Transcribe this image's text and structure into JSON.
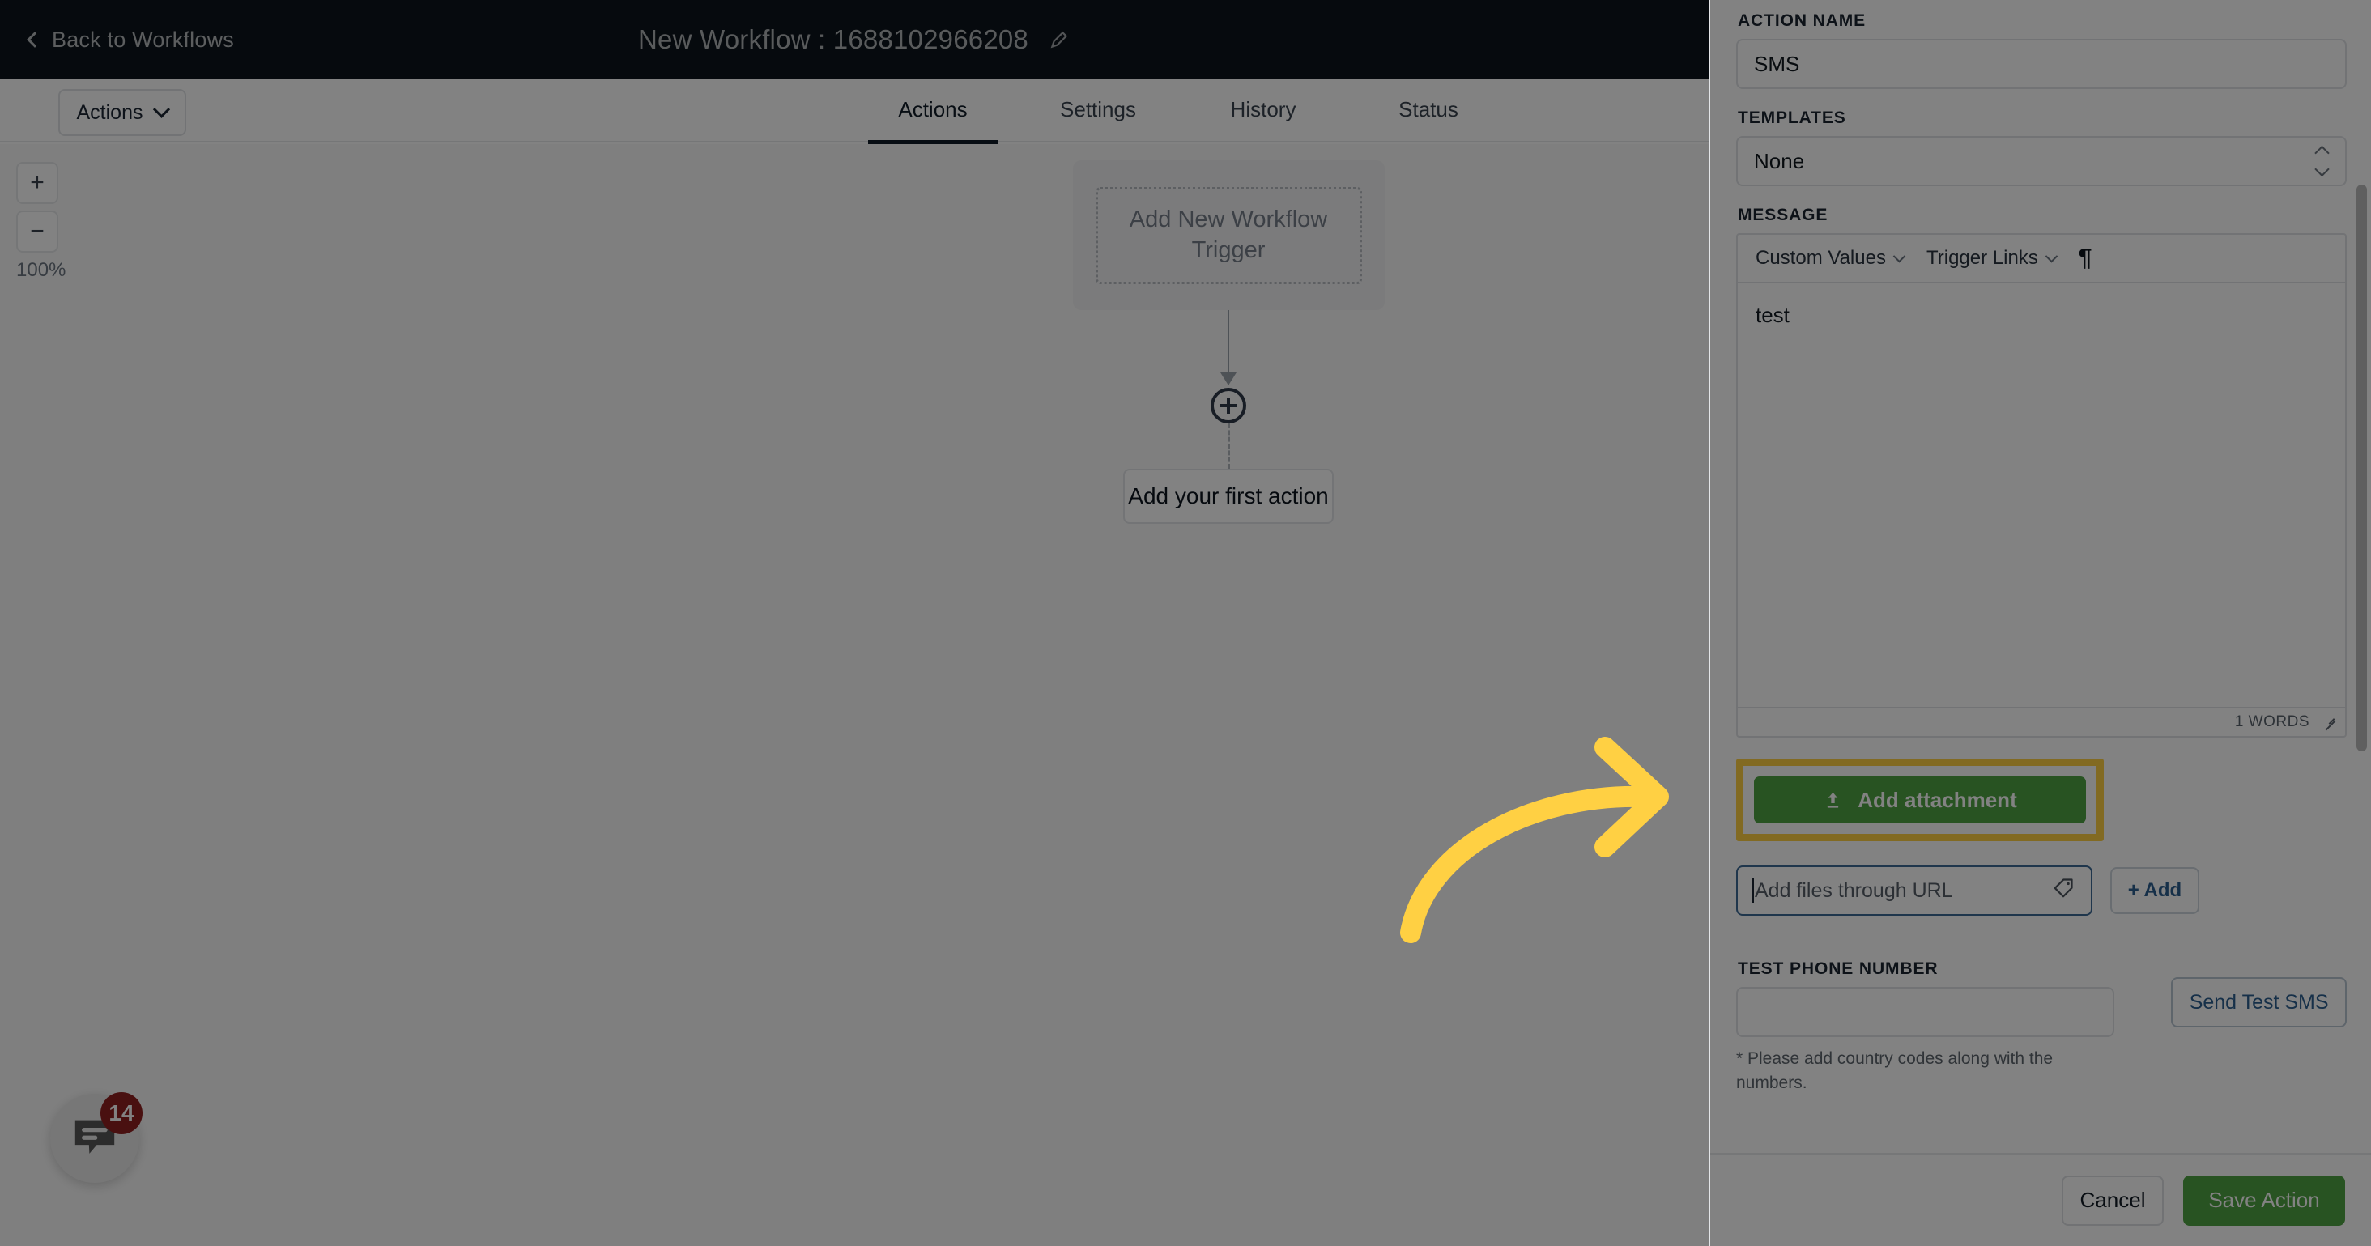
{
  "header": {
    "back_label": "Back to Workflows",
    "back_icon": "chevron-left-icon",
    "title": "New Workflow : 1688102966208",
    "edit_icon": "pencil-icon"
  },
  "toolbar": {
    "actions_dropdown_label": "Actions",
    "dropdown_icon": "chevron-down-icon"
  },
  "tabs": [
    {
      "label": "Actions",
      "active": true
    },
    {
      "label": "Settings",
      "active": false
    },
    {
      "label": "History",
      "active": false
    },
    {
      "label": "Status",
      "active": false
    }
  ],
  "canvas": {
    "zoom_in_label": "+",
    "zoom_out_label": "−",
    "zoom_level": "100%",
    "trigger_card_label": "Add New Workflow Trigger",
    "add_node_icon": "plus-circle-icon",
    "first_action_label": "Add your first action"
  },
  "chat_widget": {
    "icon": "chat-bubble-icon",
    "badge_count": "14"
  },
  "panel": {
    "action_name": {
      "label": "ACTION NAME",
      "value": "SMS",
      "placeholder": ""
    },
    "templates": {
      "label": "TEMPLATES",
      "value": "None",
      "icon": "chevron-updown-icon"
    },
    "message": {
      "label": "MESSAGE",
      "toolbar": {
        "custom_values": "Custom Values",
        "trigger_links": "Trigger Links",
        "paragraph_icon": "¶"
      },
      "body": "test",
      "word_count": "1 WORDS",
      "resize_icon": "resize-grip-icon"
    },
    "attachment": {
      "button_label": "Add attachment",
      "button_icon": "upload-icon",
      "highlight_color": "#ffd043",
      "button_color": "#4fa343"
    },
    "url_field": {
      "placeholder": "Add files through URL",
      "value": "",
      "tag_icon": "tag-icon",
      "add_button_label": "+ Add"
    },
    "test_phone": {
      "label": "TEST PHONE NUMBER",
      "value": "",
      "placeholder": "",
      "note": "* Please add country codes along with the numbers.",
      "send_button_label": "Send Test SMS"
    },
    "footer": {
      "cancel_label": "Cancel",
      "save_label": "Save Action"
    }
  },
  "annotation": {
    "arrow_color": "#ffd043",
    "arrow_name": "pointer-arrow"
  }
}
